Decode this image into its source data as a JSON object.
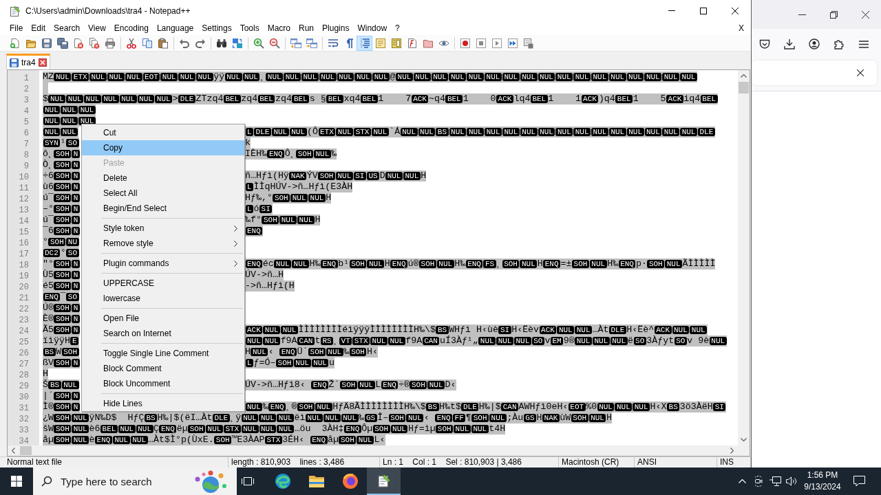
{
  "window": {
    "title": "C:\\Users\\admin\\Downloads\\tra4 - Notepad++"
  },
  "menu_bar": {
    "items": [
      "File",
      "Edit",
      "Search",
      "View",
      "Encoding",
      "Language",
      "Settings",
      "Tools",
      "Macro",
      "Run",
      "Plugins",
      "Window",
      "?"
    ],
    "close": "X"
  },
  "toolbar": [
    {
      "kind": "new",
      "pressed": false
    },
    {
      "kind": "open",
      "pressed": false
    },
    {
      "kind": "save",
      "pressed": false
    },
    {
      "kind": "saveall",
      "pressed": false
    },
    {
      "kind": "close",
      "pressed": false
    },
    {
      "kind": "closeall",
      "pressed": false
    },
    {
      "kind": "print",
      "pressed": false
    },
    {
      "kind": "separator"
    },
    {
      "kind": "cut",
      "pressed": false
    },
    {
      "kind": "copy",
      "pressed": false
    },
    {
      "kind": "paste",
      "pressed": false
    },
    {
      "kind": "separator"
    },
    {
      "kind": "undo",
      "pressed": false
    },
    {
      "kind": "redo",
      "pressed": false
    },
    {
      "kind": "separator"
    },
    {
      "kind": "find",
      "pressed": false
    },
    {
      "kind": "replace",
      "pressed": false
    },
    {
      "kind": "separator"
    },
    {
      "kind": "zoomin",
      "pressed": false
    },
    {
      "kind": "zoomout",
      "pressed": false
    },
    {
      "kind": "separator"
    },
    {
      "kind": "syncv",
      "pressed": false
    },
    {
      "kind": "synch",
      "pressed": false
    },
    {
      "kind": "separator"
    },
    {
      "kind": "wrap",
      "pressed": false
    },
    {
      "kind": "allchars",
      "pressed": false
    },
    {
      "kind": "indent",
      "pressed": true
    },
    {
      "kind": "udl",
      "pressed": false
    },
    {
      "kind": "docmap",
      "pressed": false
    },
    {
      "kind": "funclist",
      "pressed": false
    },
    {
      "kind": "workspace",
      "pressed": false
    },
    {
      "kind": "monitor",
      "pressed": false
    },
    {
      "kind": "separator"
    },
    {
      "kind": "record",
      "pressed": false
    },
    {
      "kind": "stop",
      "pressed": false
    },
    {
      "kind": "play",
      "pressed": false
    },
    {
      "kind": "playmulti",
      "pressed": false
    },
    {
      "kind": "savemacro",
      "pressed": false
    }
  ],
  "tabs": [
    {
      "label": "tra4",
      "selected": true
    }
  ],
  "editor": {
    "lines": [
      {
        "number": "1",
        "selected": true,
        "segments": [
          "MZ",
          {
            "ctrl": [
              "NUL",
              "ETX",
              "NUL",
              "NUL",
              "NUL",
              "EOT",
              "NUL",
              "NUL",
              "NUL"
            ]
          },
          "ÿÿ",
          {
            "ctrl": [
              "NUL",
              "NUL"
            ]
          },
          "¸",
          {
            "ctrl": [
              "NUL",
              "NUL",
              "NUL",
              "NUL",
              "NUL",
              "NUL",
              "NUL"
            ]
          },
          "@",
          {
            "ctrl": [
              "NUL",
              "NUL",
              "NUL",
              "NUL",
              "NUL",
              "NUL",
              "NUL",
              "NUL",
              "NUL",
              "NUL",
              "NUL",
              "NUL",
              "NUL",
              "NUL",
              "NUL",
              "NUL",
              "NUL"
            ]
          }
        ]
      },
      {
        "number": "2",
        "selected": true
      },
      {
        "number": "3",
        "selected": true,
        "segments": [
          "$",
          {
            "ctrl": [
              "NUL",
              "NUL",
              "NUL",
              "NUL",
              "NUL",
              "NUL",
              "NUL"
            ]
          },
          ">",
          {
            "ctrl": [
              "DLE"
            ]
          },
          "ZTzq4",
          {
            "ctrl": [
              "BEL"
            ]
          },
          "zq4",
          {
            "ctrl": [
              "BEL"
            ]
          },
          "zq4",
          {
            "ctrl": [
              "BEL"
            ]
          },
          "s §",
          {
            "ctrl": [
              "BEL"
            ]
          },
          "xq4",
          {
            "ctrl": [
              "BEL"
            ]
          },
          "1    7",
          {
            "ctrl": [
              "ACK"
            ]
          },
          "~q4",
          {
            "ctrl": [
              "BEL"
            ]
          },
          "1    0",
          {
            "ctrl": [
              "ACK"
            ]
          },
          "lq4",
          {
            "ctrl": [
              "BEL"
            ]
          },
          "1    1",
          {
            "ctrl": [
              "ACK"
            ]
          },
          ")q4",
          {
            "ctrl": [
              "BEL"
            ]
          },
          "1    5",
          {
            "ctrl": [
              "ACK"
            ]
          },
          "iq4",
          {
            "ctrl": [
              "BEL"
            ]
          }
        ]
      },
      {
        "number": "4",
        "selected": true,
        "segments": [
          {
            "ctrl": [
              "NUL",
              "NUL",
              "NUL"
            ]
          }
        ]
      },
      {
        "number": "5",
        "selected": true,
        "segments": [
          {
            "ctrl": [
              "NUL",
              "NUL",
              "NUL"
            ]
          }
        ]
      },
      {
        "number": "6",
        "selected": true,
        "segments": [
          {
            "ctrl": [
              "NUL",
              "NUL"
            ]
          }
        ],
        "after_menu": [
          {
            "ctrl": [
              "L",
              "DLE",
              "NUL",
              "NUL"
            ]
          },
          "(Ô",
          {
            "ctrl": [
              "ETX",
              "NUL",
              "STX",
              "NUL"
            ]
          },
          "`Á",
          {
            "ctrl": [
              "NUL",
              "NUL",
              "BS",
              "NUL",
              "NUL",
              "NUL",
              "NUL",
              "NUL",
              "NUL",
              "NUL",
              "NUL",
              "NUL",
              "NUL",
              "NUL",
              "NUL",
              "NUL",
              "NUL",
              "DLE"
            ]
          }
        ]
      },
      {
        "number": "7",
        "selected": true,
        "segments": [
          {
            "ctrl": [
              "SYN"
            ]
          },
          "¹",
          {
            "ctrl": [
              "SO"
            ]
          }
        ],
        "after_menu": [
          "k"
        ]
      },
      {
        "number": "8",
        "selected": true,
        "segments": [
          "ô¸",
          {
            "ctrl": [
              "SOH",
              "N"
            ]
          }
        ],
        "after_menu": [
          "IÈH‰",
          {
            "ctrl": [
              "ENQ"
            ]
          },
          "Ô¸",
          {
            "ctrl": [
              "SOH",
              "NUL"
            ]
          },
          "‰"
        ]
      },
      {
        "number": "9",
        "selected": true,
        "segments": [
          "Ò¸",
          {
            "ctrl": [
              "SOH",
              "N"
            ]
          }
        ]
      },
      {
        "number": "10",
        "selected": true,
        "segments": [
          "÷6",
          {
            "ctrl": [
              "SOH",
              "N"
            ]
          }
        ],
        "after_menu": [
          "ñ…Hƒì(Hÿ",
          {
            "ctrl": [
              "NAK"
            ]
          },
          "ÝV",
          {
            "ctrl": [
              "SOH",
              "NUL",
              "SI",
              "US"
            ]
          },
          "D",
          {
            "ctrl": [
              "NUL",
              "NUL"
            ]
          },
          "H"
        ]
      },
      {
        "number": "11",
        "selected": true,
        "segments": [
          "ù6",
          {
            "ctrl": [
              "SOH",
              "N"
            ]
          }
        ],
        "after_menu": [
          {
            "ctrl": [
              "L"
            ]
          },
          "ÌÌqHÚV->ñ…Hƒì(E3ÀH"
        ]
      },
      {
        "number": "12",
        "selected": true,
        "segments": [
          "ú¯",
          {
            "ctrl": [
              "SOH",
              "N"
            ]
          }
        ],
        "after_menu": [
          "Hƒ‰,°",
          {
            "ctrl": [
              "SOH",
              "NUL",
              "NUL"
            ]
          },
          "H"
        ]
      },
      {
        "number": "13",
        "selected": true,
        "segments": [
          "–°",
          {
            "ctrl": [
              "SOH",
              "N"
            ]
          }
        ],
        "after_menu": [
          {
            "ctrl": [
              "L"
            ]
          },
          "ó",
          {
            "ctrl": [
              "SI"
            ]
          }
        ]
      },
      {
        "number": "14",
        "selected": true,
        "segments": [
          "ú¯",
          {
            "ctrl": [
              "SOH",
              "N"
            ]
          }
        ],
        "after_menu": [
          "‰f°",
          {
            "ctrl": [
              "SOH",
              "NUL",
              "NUL"
            ]
          },
          "H"
        ]
      },
      {
        "number": "15",
        "selected": true,
        "segments": [
          "¯6",
          {
            "ctrl": [
              "SOH",
              "N"
            ]
          }
        ],
        "after_menu": [
          {
            "ctrl": [
              "ENQ"
            ]
          }
        ]
      },
      {
        "number": "16",
        "selected": true,
        "segments": [
          "°",
          {
            "ctrl": [
              "SOH",
              "NU"
            ]
          }
        ]
      },
      {
        "number": "17",
        "selected": true,
        "segments": [
          {
            "ctrl": [
              "DC2"
            ]
          },
          "°",
          {
            "ctrl": [
              "SO"
            ]
          }
        ]
      },
      {
        "number": "18",
        "selected": true,
        "segments": [
          "\"°",
          {
            "ctrl": [
              "SOH",
              "N"
            ]
          }
        ],
        "after_menu": [
          {
            "ctrl": [
              "ENQ"
            ]
          },
          "éc",
          {
            "ctrl": [
              "NUL",
              "NUL"
            ]
          },
          "H‰",
          {
            "ctrl": [
              "ENQ"
            ]
          },
          "b¹",
          {
            "ctrl": [
              "SOH",
              "NUL"
            ]
          },
          "H",
          {
            "ctrl": [
              "ENQ"
            ]
          },
          "ú®",
          {
            "ctrl": [
              "SOH",
              "NUL"
            ]
          },
          "H‰",
          {
            "ctrl": [
              "ENQ",
              "FS"
            ]
          },
          "¸",
          {
            "ctrl": [
              "SOH",
              "NUL"
            ]
          },
          "H",
          {
            "ctrl": [
              "ENQ"
            ]
          },
          "=±",
          {
            "ctrl": [
              "SOH",
              "NUL"
            ]
          },
          "H‰",
          {
            "ctrl": [
              "ENQ"
            ]
          },
          "p·",
          {
            "ctrl": [
              "SOH",
              "NUL"
            ]
          },
          "ÃÌÌÌÌÌ"
        ]
      },
      {
        "number": "19",
        "selected": true,
        "segments": [
          "Ù5",
          {
            "ctrl": [
              "SOH",
              "N"
            ]
          }
        ],
        "after_menu": [
          "ÚV->ñ…H"
        ]
      },
      {
        "number": "20",
        "selected": true,
        "segments": [
          "é5",
          {
            "ctrl": [
              "SOH",
              "N"
            ]
          }
        ],
        "after_menu": [
          "->ñ…Hƒì(H"
        ]
      },
      {
        "number": "21",
        "selected": true,
        "segments": [
          {
            "ctrl": [
              "ENQ"
            ]
          },
          "¯",
          {
            "ctrl": [
              "SO"
            ]
          }
        ]
      },
      {
        "number": "22",
        "selected": true,
        "segments": [
          "Ú®",
          {
            "ctrl": [
              "SOH",
              "N"
            ]
          }
        ]
      },
      {
        "number": "23",
        "selected": true,
        "segments": [
          "È®",
          {
            "ctrl": [
              "SOH",
              "N"
            ]
          }
        ]
      },
      {
        "number": "24",
        "selected": true,
        "segments": [
          "Ã5",
          {
            "ctrl": [
              "SOH",
              "N"
            ]
          }
        ],
        "after_menu": [
          {
            "ctrl": [
              "ACK",
              "NUL",
              "NUL"
            ]
          },
          "ÌÌÌÌÌÌÌÌéìÿÿÿÌÌÌÌÌÌÌÌH‰\\$",
          {
            "ctrl": [
              "BS"
            ]
          },
          "WHƒì H‹ùè",
          {
            "ctrl": [
              "SI"
            ]
          },
          "H‹Ëèv",
          {
            "ctrl": [
              "ACK",
              "NUL",
              "NUL"
            ]
          },
          "…Àt",
          {
            "ctrl": [
              "DLE"
            ]
          },
          "H‹Ëè^",
          {
            "ctrl": [
              "ACK",
              "NUL",
              "NUL"
            ]
          }
        ]
      },
      {
        "number": "25",
        "selected": true,
        "segments": [
          "ïìÿÿH",
          {
            "ctrl": [
              "E"
            ]
          }
        ],
        "after_menu": [
          {
            "ctrl": [
              "NUL",
              "NUL"
            ]
          },
          "f9A",
          {
            "ctrl": [
              "CAN"
            ]
          },
          "t",
          {
            "ctrl": [
              "RS"
            ]
          },
          "¸",
          {
            "ctrl": [
              "VT",
              "STX",
              "NUL",
              "NUL"
            ]
          },
          "f9A",
          {
            "ctrl": [
              "CAN"
            ]
          },
          "uÍ3Àƒ¹„",
          {
            "ctrl": [
              "NUL",
              "NUL",
              "NUL",
              "SO"
            ]
          },
          "v",
          {
            "ctrl": [
              "EM"
            ]
          },
          "9®",
          {
            "ctrl": [
              "NUL",
              "NUL",
              "NUL"
            ]
          },
          "ë",
          {
            "ctrl": [
              "SO"
            ]
          },
          "3Àƒyt",
          {
            "ctrl": [
              "SO"
            ]
          },
          "v 9è",
          {
            "ctrl": [
              "NUL"
            ]
          }
        ]
      },
      {
        "number": "26",
        "selected": true,
        "segments": [
          {
            "ctrl": [
              "BS"
            ]
          },
          "W",
          {
            "ctrl": [
              "SOH"
            ]
          }
        ],
        "after_menu": [
          "H",
          {
            "ctrl": [
              "NUL"
            ]
          },
          "‹ ",
          {
            "ctrl": [
              "ENQ"
            ]
          },
          "Ü´",
          {
            "ctrl": [
              "SOH",
              "NUL"
            ]
          },
          "‰",
          {
            "ctrl": [
              "SOH"
            ]
          },
          "H‹"
        ]
      },
      {
        "number": "27",
        "selected": true,
        "segments": [
          "ßV",
          {
            "ctrl": [
              "SOH",
              "N"
            ]
          }
        ],
        "after_menu": [
          {
            "ctrl": [
              "L"
            ]
          },
          "ƒ=Ó–",
          {
            "ctrl": [
              "SOH",
              "NUL",
              "NUL"
            ]
          },
          "u"
        ]
      },
      {
        "number": "28",
        "selected": true,
        "segments": [
          "H"
        ]
      },
      {
        "number": "29",
        "selected": true,
        "segments": [
          "Š",
          {
            "ctrl": [
              "BS",
              "NUL"
            ]
          }
        ],
        "after_menu": [
          "ÚV->ñ…Hƒì8‹ ",
          {
            "ctrl": [
              "ENQ"
            ]
          },
          "Ž´",
          {
            "ctrl": [
              "SOH",
              "NUL"
            ]
          },
          "L",
          {
            "ctrl": [
              "ENQ"
            ]
          },
          "÷®",
          {
            "ctrl": [
              "SOH",
              "NUL"
            ]
          },
          "D‹"
        ]
      },
      {
        "number": "30",
        "selected": true,
        "segments": [
          "|´",
          {
            "ctrl": [
              "SOH",
              "N"
            ]
          }
        ]
      },
      {
        "number": "31",
        "selected": true,
        "segments": [
          "Ì®",
          {
            "ctrl": [
              "SOH",
              "N"
            ]
          }
        ],
        "after_menu": [
          {
            "ctrl": [
              "NUL"
            ]
          },
          "‰",
          {
            "ctrl": [
              "ENQ"
            ]
          },
          "¸®",
          {
            "ctrl": [
              "SOH",
              "NUL"
            ]
          },
          "HƒÄ8ÃÌÌÌÌÌÌÌÌH‰\\$",
          {
            "ctrl": [
              "BS"
            ]
          },
          "H‰t$",
          {
            "ctrl": [
              "DLE"
            ]
          },
          "H‰|$",
          {
            "ctrl": [
              "CAN"
            ]
          },
          "AWHƒì0eH‹",
          {
            "ctrl": [
              "EOT"
            ]
          },
          "%0",
          {
            "ctrl": [
              "NUL",
              "NUL",
              "NUL"
            ]
          },
          "H‹X",
          {
            "ctrl": [
              "BS"
            ]
          },
          "3ö3ÀëH",
          {
            "ctrl": [
              "SI"
            ]
          }
        ]
      },
      {
        "number": "32",
        "selected": true,
        "segments": [
          "¿W",
          {
            "ctrl": [
              "SOH",
              "NUL"
            ]
          },
          "ÿN‰D$  HƒÇ",
          {
            "ctrl": [
              "BS"
            ]
          },
          "H‰|$(ëI…Àt",
          {
            "ctrl": [
              "DLE"
            ]
          },
          "¸ÿ",
          {
            "ctrl": [
              "NUL",
              "NUL",
              "NUL"
            ]
          },
          "ëì",
          {
            "ctrl": [
              "NUL",
              "NUL",
              "NUL"
            ]
          },
          "‰",
          {
            "ctrl": [
              "GS"
            ]
          },
          "Î–",
          {
            "ctrl": [
              "SOH",
              "NUL"
            ]
          },
          "‹ ",
          {
            "ctrl": [
              "ENQ",
              "FF"
            ]
          },
          "¶",
          {
            "ctrl": [
              "SOH",
              "NUL"
            ]
          },
          ";Àu",
          {
            "ctrl": [
              "GS"
            ]
          },
          "H",
          {
            "ctrl": [
              "NAK"
            ]
          },
          "ùW",
          {
            "ctrl": [
              "SOH",
              "NUL"
            ]
          },
          "H"
        ]
      },
      {
        "number": "33",
        "selected": true,
        "segments": [
          "šW",
          {
            "ctrl": [
              "SOH",
              "NUL"
            ]
          },
          "è6",
          {
            "ctrl": [
              "BEL",
              "NUL",
              "NUL"
            ]
          },
          "Ç",
          {
            "ctrl": [
              "ENQ"
            ]
          },
          "ëµ",
          {
            "ctrl": [
              "SOH",
              "NUL",
              "STX",
              "NUL",
              "NUL",
              "NUL"
            ]
          },
          "…öu  3ÀH‡",
          {
            "ctrl": [
              "ENQ"
            ]
          },
          "Ôµ",
          {
            "ctrl": [
              "SOH",
              "NUL"
            ]
          },
          "Hƒ=ìµ",
          {
            "ctrl": [
              "SOH",
              "NUL",
              "NUL"
            ]
          },
          "t4H"
        ]
      },
      {
        "number": "34",
        "selected": true,
        "segments": [
          "åµ",
          {
            "ctrl": [
              "SOH",
              "NUL"
            ]
          },
          "è",
          {
            "ctrl": [
              "ENQ",
              "NUL",
              "NUL"
            ]
          },
          "…Àt$Ì°p(ÙxE.",
          {
            "ctrl": [
              "SOH"
            ]
          },
          "™E3ÀAP",
          {
            "ctrl": [
              "STX"
            ]
          },
          "3ÉH‹ ",
          {
            "ctrl": [
              "ENQ"
            ]
          },
          "åµ",
          {
            "ctrl": [
              "SOH",
              "NUL"
            ]
          },
          "L‹"
        ]
      }
    ]
  },
  "context_menu": {
    "items": [
      {
        "kind": "item",
        "label": "Cut",
        "selected": false,
        "disabled": false,
        "submenu": false
      },
      {
        "kind": "item",
        "label": "Copy",
        "selected": true,
        "disabled": false,
        "submenu": false
      },
      {
        "kind": "item",
        "label": "Paste",
        "selected": false,
        "disabled": true,
        "submenu": false
      },
      {
        "kind": "item",
        "label": "Delete",
        "selected": false,
        "disabled": false,
        "submenu": false
      },
      {
        "kind": "item",
        "label": "Select All",
        "selected": false,
        "disabled": false,
        "submenu": false
      },
      {
        "kind": "item",
        "label": "Begin/End Select",
        "selected": false,
        "disabled": false,
        "submenu": false
      },
      {
        "kind": "separator"
      },
      {
        "kind": "item",
        "label": "Style token",
        "selected": false,
        "disabled": false,
        "submenu": true
      },
      {
        "kind": "item",
        "label": "Remove style",
        "selected": false,
        "disabled": false,
        "submenu": true
      },
      {
        "kind": "separator"
      },
      {
        "kind": "item",
        "label": "Plugin commands",
        "selected": false,
        "disabled": false,
        "submenu": true
      },
      {
        "kind": "separator"
      },
      {
        "kind": "item",
        "label": "UPPERCASE",
        "selected": false,
        "disabled": false,
        "submenu": false
      },
      {
        "kind": "item",
        "label": "lowercase",
        "selected": false,
        "disabled": false,
        "submenu": false
      },
      {
        "kind": "separator"
      },
      {
        "kind": "item",
        "label": "Open File",
        "selected": false,
        "disabled": false,
        "submenu": false
      },
      {
        "kind": "item",
        "label": "Search on Internet",
        "selected": false,
        "disabled": false,
        "submenu": false
      },
      {
        "kind": "separator"
      },
      {
        "kind": "item",
        "label": "Toggle Single Line Comment",
        "selected": false,
        "disabled": false,
        "submenu": false
      },
      {
        "kind": "item",
        "label": "Block Comment",
        "selected": false,
        "disabled": false,
        "submenu": false
      },
      {
        "kind": "item",
        "label": "Block Uncomment",
        "selected": false,
        "disabled": false,
        "submenu": false
      },
      {
        "kind": "separator"
      },
      {
        "kind": "item",
        "label": "Hide Lines",
        "selected": false,
        "disabled": false,
        "submenu": false
      }
    ]
  },
  "status_bar": {
    "fields": [
      "Normal text file",
      "length : 810,903    lines : 3,486",
      "Ln : 1    Col : 1    Sel : 810,903 | 3,486",
      "Macintosh (CR)",
      "ANSI",
      "INS"
    ]
  },
  "taskbar": {
    "search": {
      "placeholder": "Type here to search"
    },
    "apps": [
      {
        "kind": "taskview",
        "active": false
      },
      {
        "kind": "edge",
        "active": false
      },
      {
        "kind": "explorer",
        "active": false
      },
      {
        "kind": "firefox",
        "active": false
      },
      {
        "kind": "notepad",
        "active": true
      }
    ],
    "clock": {
      "time": "1:56 PM",
      "date": "9/13/2024"
    }
  }
}
